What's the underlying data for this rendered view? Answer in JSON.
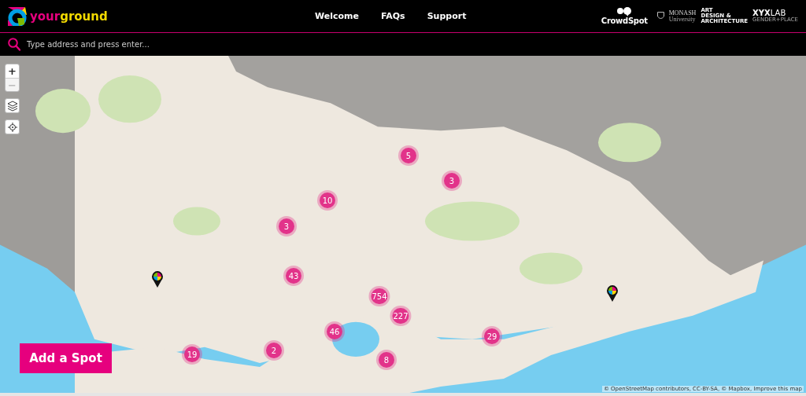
{
  "logo": {
    "text_1": "your",
    "text_2": "ground"
  },
  "nav": [
    {
      "label": "Welcome"
    },
    {
      "label": "FAQs"
    },
    {
      "label": "Support"
    }
  ],
  "partners": {
    "crowdspot": "CrowdSpot",
    "monash_1": "MONASH",
    "monash_2": "University",
    "faculty_1": "ART",
    "faculty_2": "DESIGN &",
    "faculty_3": "ARCHITECTURE",
    "xyx_1": "XYX",
    "xyx_2": "LAB",
    "xyx_3": "GENDER+PLACE"
  },
  "search": {
    "placeholder": "Type address and press enter..."
  },
  "map_controls": [
    {
      "kind": "zoom",
      "label": "+",
      "disabled": false
    },
    {
      "kind": "zoom",
      "label": "−",
      "disabled": true
    },
    {
      "kind": "layers"
    },
    {
      "kind": "locate"
    }
  ],
  "clusters": [
    {
      "count": "5"
    },
    {
      "count": "3"
    },
    {
      "count": "10"
    },
    {
      "count": "3"
    },
    {
      "count": "43"
    },
    {
      "count": "754"
    },
    {
      "count": "227"
    },
    {
      "count": "46"
    },
    {
      "count": "29"
    },
    {
      "count": "2"
    },
    {
      "count": "19"
    },
    {
      "count": "8"
    }
  ],
  "add_button": {
    "label": "Add a Spot"
  },
  "attribution": "© OpenStreetMap contributors, CC-BY-SA, © Mapbox, Improve this map"
}
